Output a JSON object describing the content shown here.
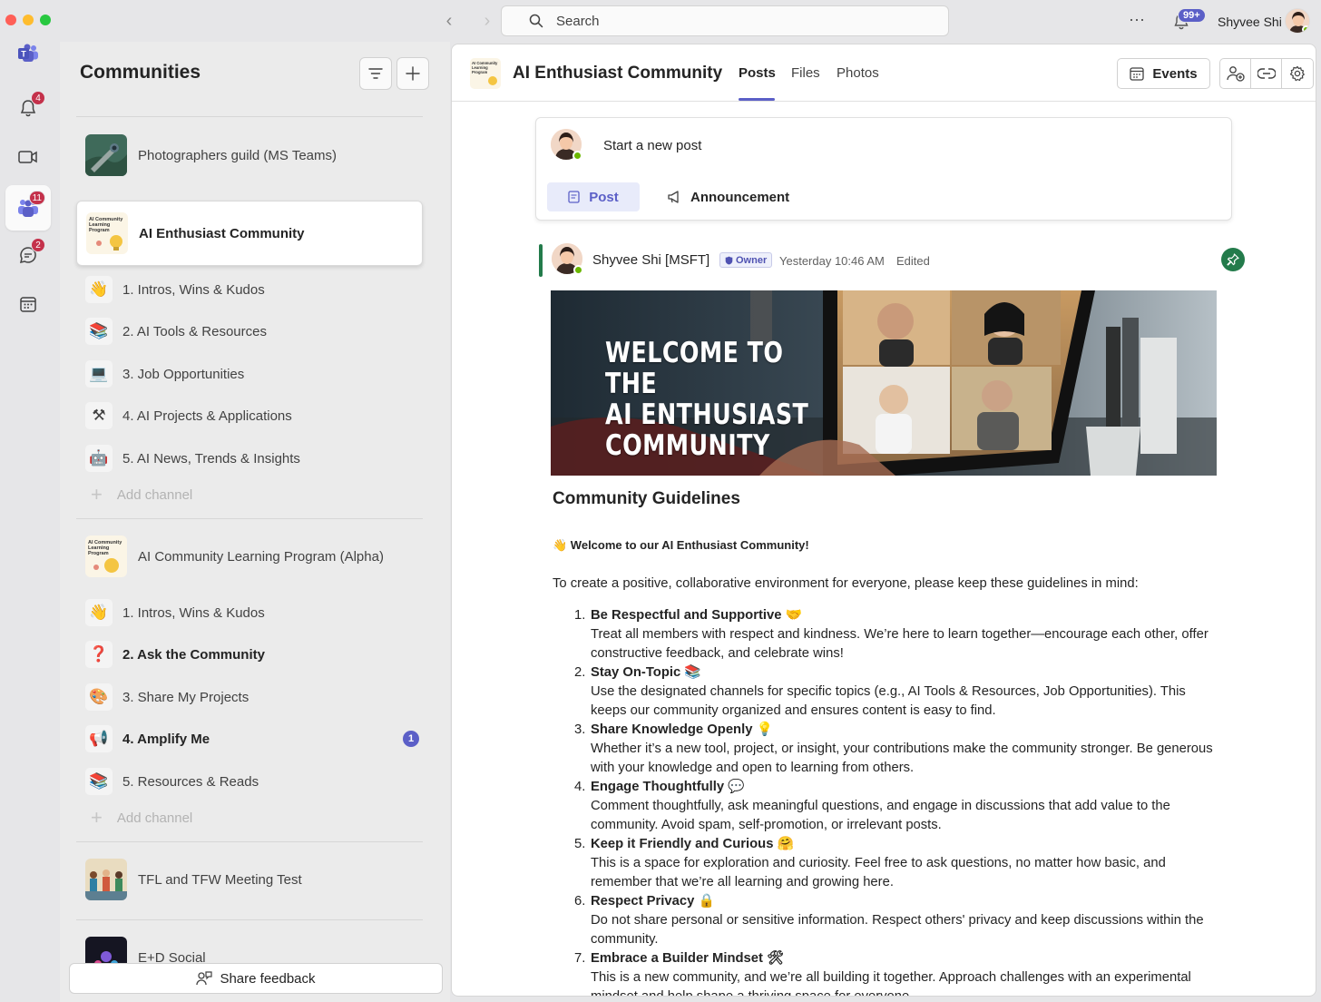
{
  "titlebar": {
    "search_placeholder": "Search",
    "activity_badge": "99+",
    "user_name": "Shyvee Shi"
  },
  "rail": {
    "activity_badge": "4",
    "teams_badge": "11",
    "chat_badge": "2"
  },
  "sidebar": {
    "title": "Communities",
    "teams": [
      {
        "name": "Photographers guild (MS Teams)"
      },
      {
        "name": "AI Enthusiast Community",
        "channels": [
          {
            "label": "1. Intros, Wins & Kudos",
            "icon": "👋"
          },
          {
            "label": "2. AI Tools & Resources",
            "icon": "📚"
          },
          {
            "label": "3. Job Opportunities",
            "icon": "💻"
          },
          {
            "label": "4. AI Projects & Applications",
            "icon": "⚒"
          },
          {
            "label": "5. AI News, Trends & Insights",
            "icon": "🤖"
          }
        ]
      },
      {
        "name": "AI Community Learning Program (Alpha)",
        "channels": [
          {
            "label": "1. Intros, Wins & Kudos",
            "icon": "👋"
          },
          {
            "label": "2. Ask the Community",
            "icon": "❓"
          },
          {
            "label": "3. Share My Projects",
            "icon": "🎨"
          },
          {
            "label": "4. Amplify Me",
            "icon": "📢",
            "badge": "1"
          },
          {
            "label": "5. Resources & Reads",
            "icon": "📚"
          }
        ]
      },
      {
        "name": "TFL and TFW Meeting Test"
      },
      {
        "name": "E+D Social"
      }
    ],
    "add_channel": "Add channel",
    "feedback": "Share feedback"
  },
  "header": {
    "title": "AI Enthusiast Community",
    "tabs": [
      "Posts",
      "Files",
      "Photos"
    ],
    "events": "Events"
  },
  "compose": {
    "placeholder": "Start a new post",
    "post": "Post",
    "announcement": "Announcement"
  },
  "post": {
    "author": "Shyvee Shi [MSFT]",
    "role": "Owner",
    "time": "Yesterday 10:46 AM",
    "edited": "Edited",
    "banner_lines": [
      "WELCOME TO THE",
      "AI ENTHUSIAST",
      "COMMUNITY"
    ],
    "heading": "Community Guidelines",
    "welcome": "👋 Welcome to our AI Enthusiast Community!",
    "intro": "To create a positive, collaborative environment for everyone, please keep these guidelines in mind:",
    "rules": [
      {
        "n": "1.",
        "title": "Be Respectful and Supportive 🤝",
        "text": "Treat all members with respect and kindness. We’re here to learn together—encourage each other, offer constructive feedback, and celebrate wins!"
      },
      {
        "n": "2.",
        "title": "Stay On-Topic 📚",
        "text": "Use the designated channels for specific topics (e.g., AI Tools & Resources, Job Opportunities). This keeps our community organized and ensures content is easy to find."
      },
      {
        "n": "3.",
        "title": "Share Knowledge Openly 💡",
        "text": "Whether it’s a new tool, project, or insight, your contributions make the community stronger. Be generous with your knowledge and open to learning from others."
      },
      {
        "n": "4.",
        "title": "Engage Thoughtfully 💬",
        "text": "Comment thoughtfully, ask meaningful questions, and engage in discussions that add value to the community. Avoid spam, self-promotion, or irrelevant posts."
      },
      {
        "n": "5.",
        "title": "Keep it Friendly and Curious 🤗",
        "text": "This is a space for exploration and curiosity. Feel free to ask questions, no matter how basic, and remember that we’re all learning and growing here."
      },
      {
        "n": "6.",
        "title": "Respect Privacy 🔒",
        "text": "Do not share personal or sensitive information. Respect others' privacy and keep discussions within the community."
      },
      {
        "n": "7.",
        "title": "Embrace a Builder Mindset 🛠",
        "text": "This is a new community, and we’re all building it together. Approach challenges with an experimental mindset and help shape a thriving space for everyone."
      }
    ]
  }
}
